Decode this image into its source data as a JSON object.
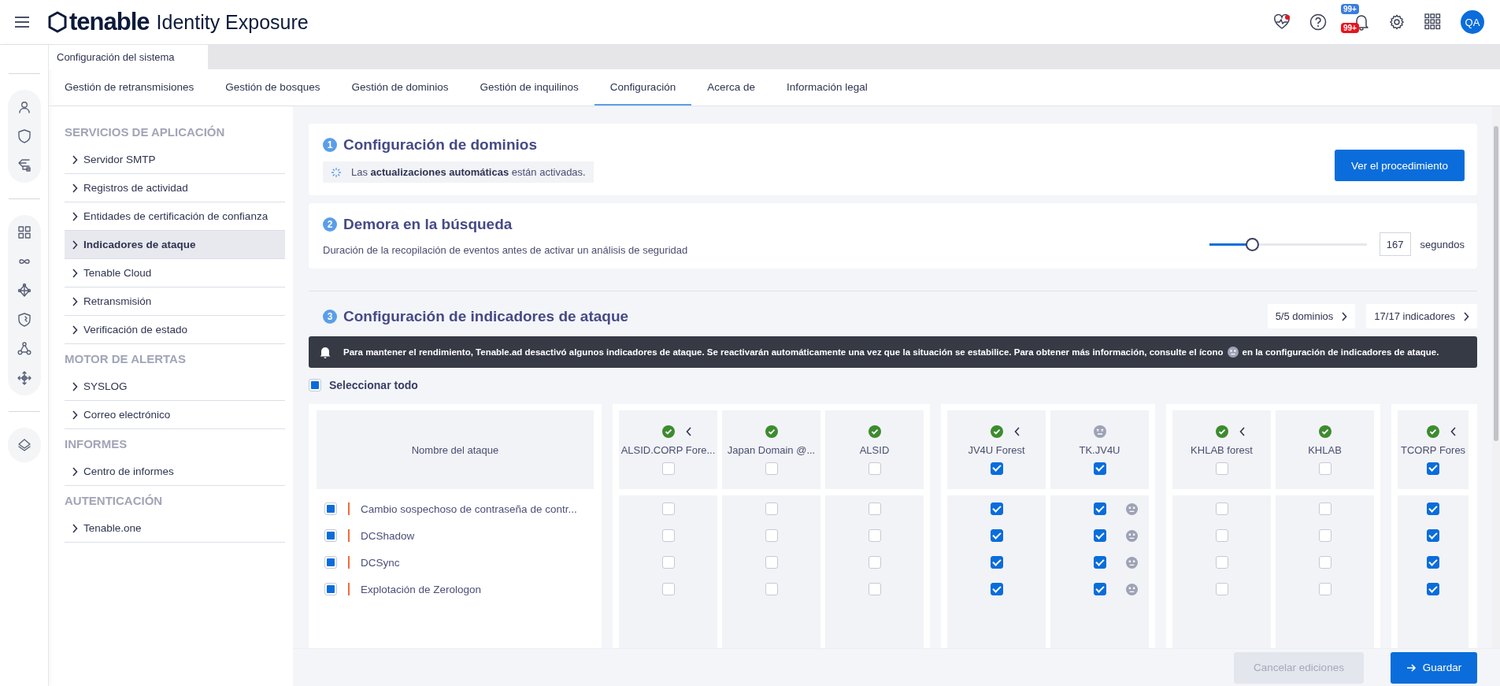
{
  "topbar": {
    "logo_word": "tenable",
    "product": "Identity Exposure",
    "badges": [
      {
        "text": "99+",
        "color": "#3b7ddd"
      },
      {
        "text": "99+",
        "color": "#e8141c"
      }
    ],
    "avatar": "QA"
  },
  "breadcrumb": "Configuración del sistema",
  "tabs": [
    {
      "label": "Gestión de retransmisiones",
      "selected": false
    },
    {
      "label": "Gestión de bosques",
      "selected": false
    },
    {
      "label": "Gestión de dominios",
      "selected": false
    },
    {
      "label": "Gestión de inquilinos",
      "selected": false
    },
    {
      "label": "Configuración",
      "selected": true
    },
    {
      "label": "Acerca de",
      "selected": false
    },
    {
      "label": "Información legal",
      "selected": false
    }
  ],
  "sidebar": {
    "sections": [
      {
        "title": "SERVICIOS DE APLICACIÓN",
        "items": [
          {
            "label": "Servidor SMTP",
            "selected": false
          },
          {
            "label": "Registros de actividad",
            "selected": false
          },
          {
            "label": "Entidades de certificación de confianza",
            "selected": false
          },
          {
            "label": "Indicadores de ataque",
            "selected": true
          },
          {
            "label": "Tenable Cloud",
            "selected": false
          },
          {
            "label": "Retransmisión",
            "selected": false
          },
          {
            "label": "Verificación de estado",
            "selected": false
          }
        ]
      },
      {
        "title": "MOTOR DE ALERTAS",
        "items": [
          {
            "label": "SYSLOG",
            "selected": false
          },
          {
            "label": "Correo electrónico",
            "selected": false
          }
        ]
      },
      {
        "title": "INFORMES",
        "items": [
          {
            "label": "Centro de informes",
            "selected": false
          }
        ]
      },
      {
        "title": "AUTENTICACIÓN",
        "items": [
          {
            "label": "Tenable.one",
            "selected": false
          }
        ]
      }
    ]
  },
  "domains_card": {
    "number": "1",
    "title": "Configuración de dominios",
    "notice": "Las **actualizaciones automáticas** están activadas.",
    "button": "Ver el procedimiento"
  },
  "delay_card": {
    "number": "2",
    "title": "Demora en la búsqueda",
    "description": "Duración de la recopilación de eventos antes de activar un análisis de seguridad",
    "slider": {
      "level": 0.27
    },
    "value": "167",
    "unit": "segundos"
  },
  "ioa_section": {
    "number": "3",
    "title": "Configuración de indicadores de ataque",
    "filters": [
      "5/5 dominios",
      "17/17 indicadores"
    ],
    "alert": {
      "before": "Para mantener el rendimiento, Tenable.ad desactivó algunos indicadores de ataque. Se reactivarán automáticamente una vez que la situación se estabilice. Para obtener más información, consulte el ícono",
      "after": "en la configuración de indicadores de ataque."
    },
    "select_all": {
      "label": "Seleccionar todo",
      "checked": true
    },
    "name_header": "Nombre del ataque",
    "forests": [
      {
        "columns": [
          {
            "name": "ALSID.CORP Fore...",
            "disabled": false,
            "collapse": true,
            "checked": false
          },
          {
            "name": "Japan Domain @...",
            "disabled": false,
            "collapse": false,
            "checked": false
          },
          {
            "name": "ALSID",
            "disabled": false,
            "collapse": false,
            "checked": false
          }
        ]
      },
      {
        "columns": [
          {
            "name": "JV4U Forest",
            "disabled": false,
            "collapse": true,
            "checked": true
          },
          {
            "name": "TK.JV4U",
            "disabled": true,
            "collapse": false,
            "checked": true
          }
        ]
      },
      {
        "columns": [
          {
            "name": "KHLAB forest",
            "disabled": false,
            "collapse": true,
            "checked": false
          },
          {
            "name": "KHLAB",
            "disabled": false,
            "collapse": false,
            "checked": false
          }
        ]
      },
      {
        "columns": [
          {
            "name": "TCORP Fores",
            "disabled": false,
            "collapse": true,
            "checked": true
          }
        ]
      }
    ],
    "attacks": [
      {
        "name": "Cambio sospechoso de contraseña de contr...",
        "color": "#f26b3a",
        "checked": true,
        "cells": [
          false,
          false,
          false,
          true,
          true,
          false,
          false,
          true
        ]
      },
      {
        "name": "DCShadow",
        "color": "#f26b3a",
        "checked": true,
        "cells": [
          false,
          false,
          false,
          true,
          true,
          false,
          false,
          true
        ]
      },
      {
        "name": "DCSync",
        "color": "#f26b3a",
        "checked": true,
        "cells": [
          false,
          false,
          false,
          true,
          true,
          false,
          false,
          true
        ]
      },
      {
        "name": "Explotación de Zerologon",
        "color": "#f26b3a",
        "checked": true,
        "cells": [
          false,
          false,
          false,
          true,
          true,
          false,
          false,
          true
        ]
      }
    ]
  },
  "footer": {
    "cancel": {
      "label": "Cancelar ediciones",
      "disabled": true
    },
    "save": "Guardar"
  }
}
